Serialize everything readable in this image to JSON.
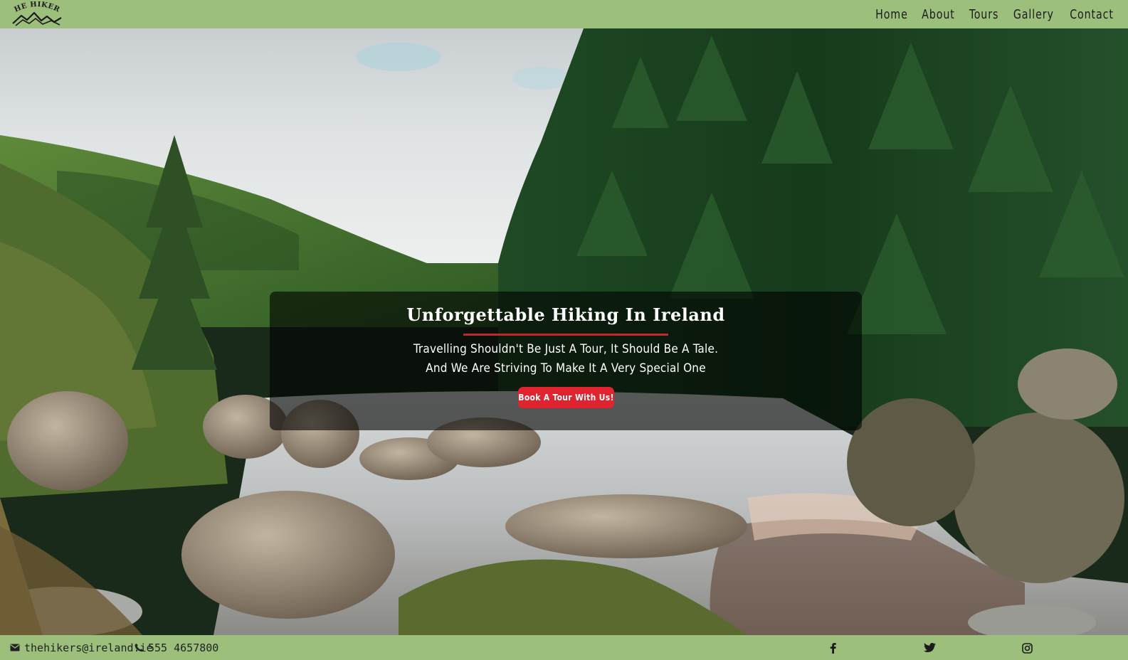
{
  "nav": {
    "logo_text": "THE HIKERS",
    "links": [
      "Home",
      "About",
      "Tours",
      "Gallery",
      "Contact"
    ]
  },
  "hero": {
    "headline": "Unforgettable Hiking In Ireland",
    "subtitle_line1": "Travelling Shouldn't Be Just A Tour, It Should Be A Tale.",
    "subtitle_line2": "And We Are Striving To Make It A Very Special One",
    "cta_label": "Book A Tour With Us!"
  },
  "footer": {
    "email": "thehikers@ireland.ie",
    "phone": "555 4657800",
    "social": [
      "facebook-icon",
      "twitter-icon",
      "instagram-icon"
    ]
  },
  "colors": {
    "nav_bg": "#9dbf7c",
    "accent_red": "#e0242f",
    "text_dark": "#1b1b1b"
  }
}
